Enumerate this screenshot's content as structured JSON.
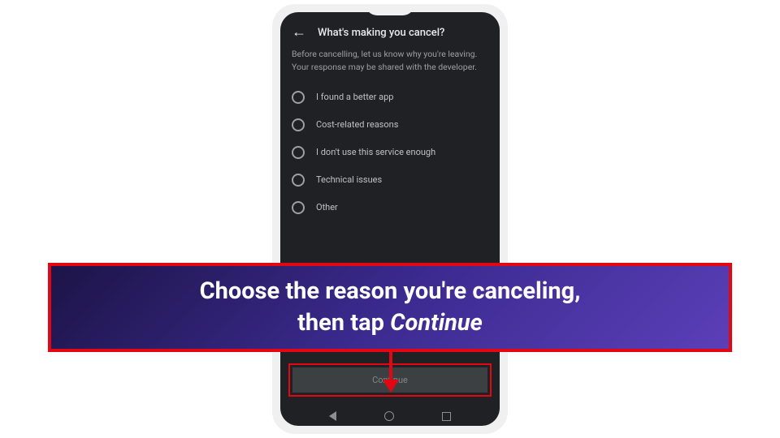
{
  "header": {
    "title": "What's making you cancel?"
  },
  "description": "Before cancelling, let us know why you're leaving. Your response may be shared with the developer.",
  "options": [
    "I found a better app",
    "Cost-related reasons",
    "I don't use this service enough",
    "Technical issues",
    "Other"
  ],
  "continue_label": "Continue",
  "callout": {
    "line1": "Choose the reason you're canceling,",
    "line2_prefix": "then tap ",
    "line2_em": "Continue"
  }
}
